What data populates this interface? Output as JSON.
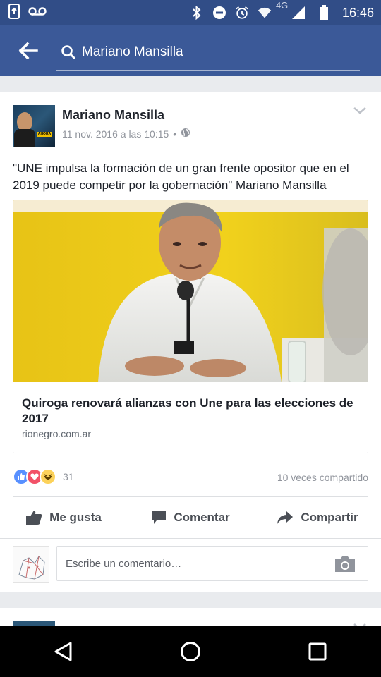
{
  "status_bar": {
    "network_label": "4G",
    "time": "16:46"
  },
  "search": {
    "value": "Mariano Mansilla",
    "back_icon": "arrow-left-icon",
    "search_icon": "magnifier-icon"
  },
  "post": {
    "author": "Mariano Mansilla",
    "date": "11 nov. 2016 a las 10:15",
    "separator": "•",
    "privacy_icon": "globe-icon",
    "text": "\"UNE impulsa la formación de un gran frente opositor que en el 2019 puede competir por la gobernación\" Mariano Mansilla",
    "avatar_badge": "AHORA",
    "link": {
      "title": "Quiroga renovará alianzas con Une para las elecciones de 2017",
      "domain": "rionegro.com.ar"
    },
    "reactions": {
      "icons": [
        "like-icon",
        "love-icon",
        "haha-icon"
      ],
      "count": "31",
      "shares": "10 veces compartido"
    },
    "actions": {
      "like": "Me gusta",
      "comment": "Comentar",
      "share": "Compartir"
    },
    "comment_placeholder": "Escribe un comentario…"
  },
  "colors": {
    "brand": "#3b5998",
    "status_bar": "#314d87",
    "like_blue": "#5890ff",
    "love_red": "#f25268",
    "haha_yellow": "#fcd25a"
  }
}
